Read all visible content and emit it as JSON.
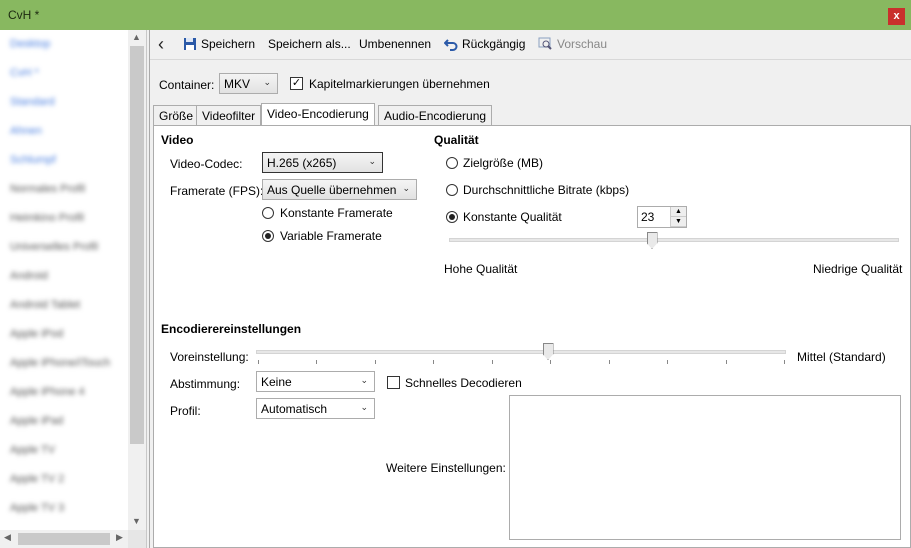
{
  "window": {
    "title": "CvH *",
    "close_label": "x"
  },
  "sidebar": {
    "items": [
      {
        "label": "Desktop",
        "blue": true
      },
      {
        "label": "CvH *",
        "blue": true
      },
      {
        "label": "Standard",
        "blue": true
      },
      {
        "label": "Ahnen",
        "blue": true
      },
      {
        "label": "Schlumpf",
        "blue": true
      },
      {
        "label": "Normales Profil",
        "blue": false
      },
      {
        "label": "Heimkino Profil",
        "blue": false
      },
      {
        "label": "Universelles Profil",
        "blue": false
      },
      {
        "label": "Android",
        "blue": false
      },
      {
        "label": "Android Tablet",
        "blue": false
      },
      {
        "label": "Apple iPod",
        "blue": false
      },
      {
        "label": "Apple iPhone/iTouch",
        "blue": false
      },
      {
        "label": "Apple iPhone 4",
        "blue": false
      },
      {
        "label": "Apple iPad",
        "blue": false
      },
      {
        "label": "Apple TV",
        "blue": false
      },
      {
        "label": "Apple TV 2",
        "blue": false
      },
      {
        "label": "Apple TV 3",
        "blue": false
      }
    ]
  },
  "toolbar": {
    "save": "Speichern",
    "save_as": "Speichern als...",
    "rename": "Umbenennen",
    "undo": "Rückgängig",
    "preview": "Vorschau"
  },
  "container": {
    "label": "Container:",
    "value": "MKV",
    "chapter_checkbox": "Kapitelmarkierungen übernehmen",
    "chapter_checked": true
  },
  "tabs": [
    "Größe",
    "Videofilter",
    "Video-Encodierung",
    "Audio-Encodierung"
  ],
  "active_tab": 2,
  "video": {
    "heading": "Video",
    "codec_label": "Video-Codec:",
    "codec_value": "H.265 (x265)",
    "fps_label": "Framerate (FPS):",
    "fps_value": "Aus Quelle übernehmen",
    "constant_fps": "Konstante Framerate",
    "variable_fps": "Variable Framerate",
    "fps_mode": "variable"
  },
  "quality": {
    "heading": "Qualität",
    "target_size": "Zielgröße (MB)",
    "avg_bitrate": "Durchschnittliche Bitrate (kbps)",
    "constant_quality": "Konstante Qualität",
    "mode": "constant",
    "value": "23",
    "slider_fraction": 0.45,
    "low_label": "Hohe Qualität",
    "high_label": "Niedrige Qualität"
  },
  "encoder": {
    "heading": "Encodierereinstellungen",
    "preset_label": "Voreinstellung:",
    "preset_value": "Mittel (Standard)",
    "preset_fraction": 0.55,
    "tune_label": "Abstimmung:",
    "tune_value": "Keine",
    "fast_decode": "Schnelles Decodieren",
    "fast_decode_checked": false,
    "profile_label": "Profil:",
    "profile_value": "Automatisch",
    "more_label": "Weitere Einstellungen:",
    "more_value": ""
  },
  "icons": {
    "back": "chevron-left-icon",
    "save": "floppy-disk-icon",
    "undo": "undo-arrow-icon",
    "preview": "magnifier-icon"
  }
}
